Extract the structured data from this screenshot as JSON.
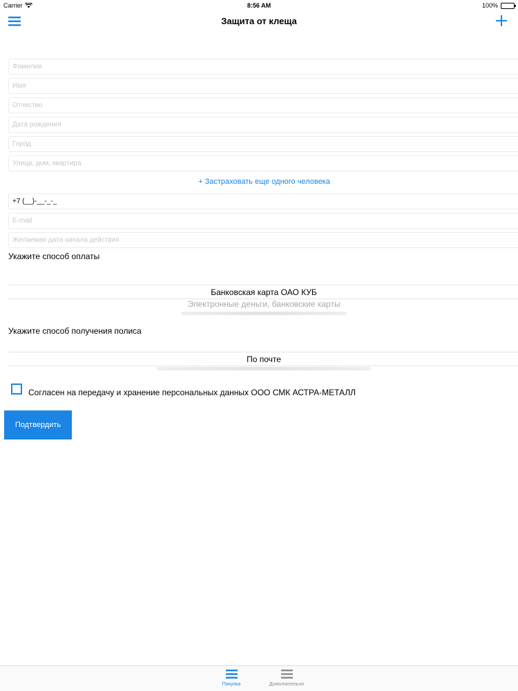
{
  "status_bar": {
    "carrier": "Carrier",
    "time": "8:56 AM",
    "battery": "100%"
  },
  "nav": {
    "title": "Защита от клеща",
    "menu_icon": "hamburger-menu-icon",
    "add_icon": "plus-icon"
  },
  "form": {
    "surname_placeholder": "Фамилия",
    "name_placeholder": "Имя",
    "patronymic_placeholder": "Отчество",
    "birthdate_placeholder": "Дата рождения",
    "city_placeholder": "Город",
    "address_placeholder": "Улица, дом, квартира",
    "add_person": "+ Застраховать еще одного человека",
    "phone_value": "+7 (__)-__-_-_",
    "email_placeholder": "E-mail",
    "start_date_placeholder": "Желаемая дата начала действия"
  },
  "payment": {
    "label": "Укажите способ оплаты",
    "selected": "Банковская карта ОАО КУБ",
    "option_2": "Электронные деньги, банковские карты"
  },
  "delivery": {
    "label": "Укажите способ получения полиса",
    "selected": "По почте"
  },
  "consent": {
    "text": "Согласен на передачу и хранение персональных данных ООО СМК АСТРА-МЕТАЛЛ"
  },
  "confirm_label": "Подтвердить",
  "tabs": [
    {
      "label": "Покупка"
    },
    {
      "label": "Дополнительно"
    }
  ],
  "colors": {
    "accent": "#1a85e3"
  }
}
